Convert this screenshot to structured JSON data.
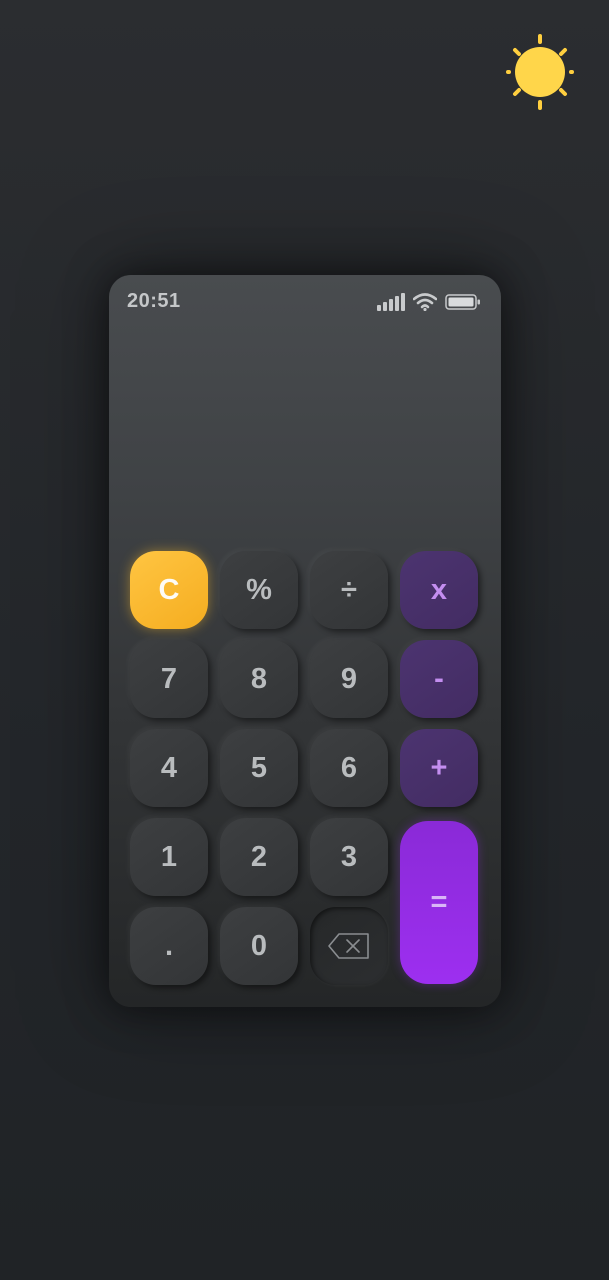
{
  "status_bar": {
    "time": "20:51",
    "icons": [
      "signal-icon",
      "wifi-icon",
      "battery-icon"
    ]
  },
  "display": {
    "expression": "",
    "result": ""
  },
  "theme_toggle": {
    "icon": "sun-icon",
    "color": "#ffcf3f"
  },
  "keys": {
    "clear": "C",
    "percent": "%",
    "divide": "÷",
    "multiply": "x",
    "seven": "7",
    "eight": "8",
    "nine": "9",
    "minus": "-",
    "four": "4",
    "five": "5",
    "six": "6",
    "plus": "+",
    "one": "1",
    "two": "2",
    "three": "3",
    "equals": "=",
    "decimal": ".",
    "zero": "0",
    "delete": "backspace-icon"
  },
  "colors": {
    "accent_clear": "#f9b92b",
    "accent_operator": "#4a3070",
    "accent_equals": "#9b2ef0",
    "key_bg": "#38393b",
    "key_text": "#b9bcbe"
  }
}
